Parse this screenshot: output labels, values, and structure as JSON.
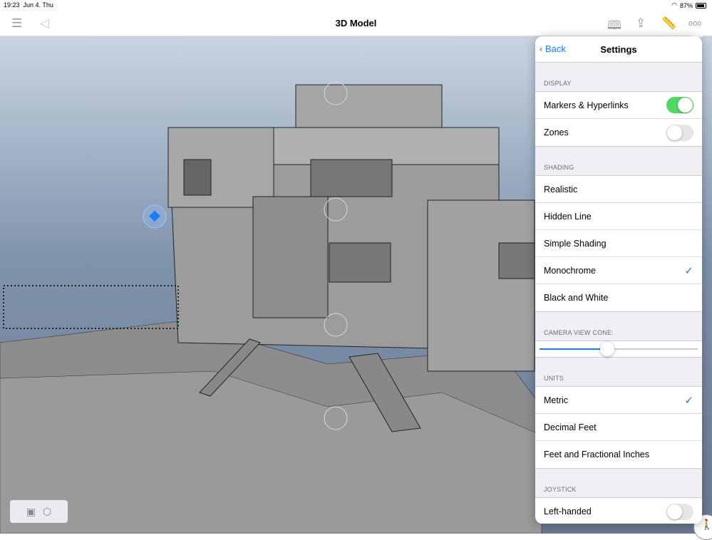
{
  "status": {
    "time": "19:23",
    "date": "Jun 4. Thu",
    "battery": "87%",
    "battery_level": 0.87
  },
  "nav": {
    "title": "3D Model",
    "icons": [
      "menu-icon",
      "back-arrow-icon",
      "book-icon",
      "share-icon",
      "ruler-icon",
      "more-icon"
    ]
  },
  "settings": {
    "back": "Back",
    "title": "Settings",
    "display": {
      "header": "DISPLAY",
      "items": [
        {
          "label": "Markers & Hyperlinks",
          "on": true
        },
        {
          "label": "Zones",
          "on": false
        }
      ]
    },
    "shading": {
      "header": "SHADING",
      "items": [
        "Realistic",
        "Hidden Line",
        "Simple Shading",
        "Monochrome",
        "Black and White"
      ],
      "selected": "Monochrome"
    },
    "camera": {
      "header": "CAMERA VIEW CONE:",
      "value": 0.43
    },
    "units": {
      "header": "UNITS",
      "items": [
        "Metric",
        "Decimal Feet",
        "Feet and Fractional Inches"
      ],
      "selected": "Metric"
    },
    "joystick": {
      "header": "JOYSTICK",
      "items": [
        {
          "label": "Left-handed",
          "on": false
        }
      ]
    }
  },
  "marks": {
    "check": "✓"
  }
}
